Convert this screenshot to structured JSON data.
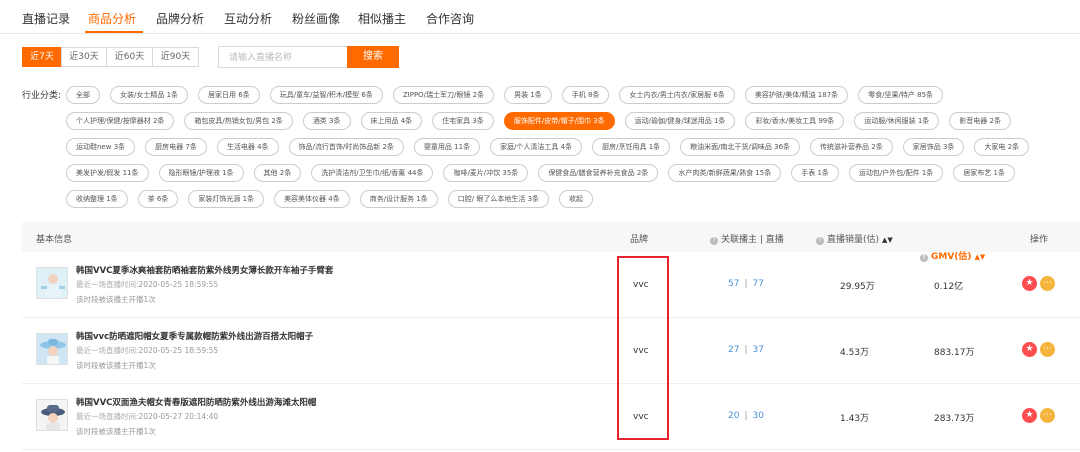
{
  "tabs": [
    "直播记录",
    "商品分析",
    "品牌分析",
    "互动分析",
    "粉丝画像",
    "相似播主",
    "合作咨询"
  ],
  "active_tab": "商品分析",
  "periods": [
    "近7天",
    "近30天",
    "近60天",
    "近90天"
  ],
  "active_period": "近7天",
  "search": {
    "placeholder": "请输入直播名称",
    "button": "搜索"
  },
  "category_label": "行业分类:",
  "categories": [
    [
      "全部",
      "女装/女士精品 1条",
      "居家日用 6条",
      "玩具/童车/益智/积木/模型 6条",
      "ZIPPO/瑞士军刀/眼镜 2条",
      "男装 1条",
      "手机 8条",
      "女士内衣/男士内衣/家居服 6条",
      "美容护肤/美体/精油 187条",
      "零食/坚果/特产 85条"
    ],
    [
      "个人护理/保健/按摩器材 2条",
      "箱包皮具/热销女包/男包 2条",
      "酒类 3条",
      "床上用品 4条",
      "住宅家具 3条",
      "服饰配件/皮带/帽子/围巾 3条",
      "运动/瑜伽/健身/球迷用品 1条",
      "彩妆/香水/美妆工具 99条",
      "运动服/休闲服装 1条",
      "影音电器 2条"
    ],
    [
      "运动鞋new 3条",
      "厨房电器 7条",
      "生活电器 4条",
      "饰品/流行首饰/时尚饰品新 2条",
      "婴童用品 11条",
      "家庭/个人清洁工具 4条",
      "厨房/烹饪用具 1条",
      "粮油米面/南北干货/调味品 36条",
      "传统滋补营养品 2条",
      "家居饰品 3条",
      "大家电 2条"
    ],
    [
      "美发护发/假发 11条",
      "隐形眼镜/护理液 1条",
      "其他 2条",
      "洗护清洁剂/卫生巾/纸/香薰 44条",
      "咖啡/麦片/冲饮 35条",
      "保健食品/膳食营养补充食品 2条",
      "水产肉类/新鲜蔬果/熟食 15条",
      "手表 1条",
      "运动包/户外包/配件 1条",
      "居家布艺 1条"
    ],
    [
      "收纳整理 1条",
      "茶 6条",
      "家装灯饰光源 1条",
      "美容美体仪器 4条",
      "商务/设计服务 1条",
      "口腔/ 眼了么本地生活 3条",
      "收起"
    ]
  ],
  "active_category": "服饰配件/皮带/帽子/围巾 3条",
  "table": {
    "headers": {
      "basic": "基本信息",
      "brand": "品牌",
      "hosts": "关联播主 | 直播",
      "sales": "直播销量(估)",
      "gmv": "GMV(估)",
      "ops": "操作"
    },
    "last_live_label": "最近一场直播时间:",
    "rows": [
      {
        "name": "韩国VVC夏季冰爽袖套防晒袖套防紫外线男女薄长款开车袖子手臂套",
        "last_live": "2020-05-25 18:59:55",
        "note": "该时段被该播主开播1次",
        "brand": "vvc",
        "hosts": "57",
        "lives": "77",
        "sales": "29.95万",
        "gmv": "0.12亿"
      },
      {
        "name": "韩国vvc防晒遮阳帽女夏季专属款帽防紫外线出游百搭太阳帽子",
        "last_live": "2020-05-25 18:59:55",
        "note": "该时段被该播主开播1次",
        "brand": "vvc",
        "hosts": "27",
        "lives": "37",
        "sales": "4.53万",
        "gmv": "883.17万"
      },
      {
        "name": "韩国VVC双面渔夫帽女青春版遮阳防晒防紫外线出游海滩太阳帽",
        "last_live": "2020-05-27 20:14:40",
        "note": "该时段被该播主开播1次",
        "brand": "vvc",
        "hosts": "20",
        "lives": "30",
        "sales": "1.43万",
        "gmv": "283.73万"
      }
    ]
  },
  "colors": {
    "accent": "#ff6a00",
    "link": "#4a90d9",
    "highlight": "#e3242b"
  }
}
